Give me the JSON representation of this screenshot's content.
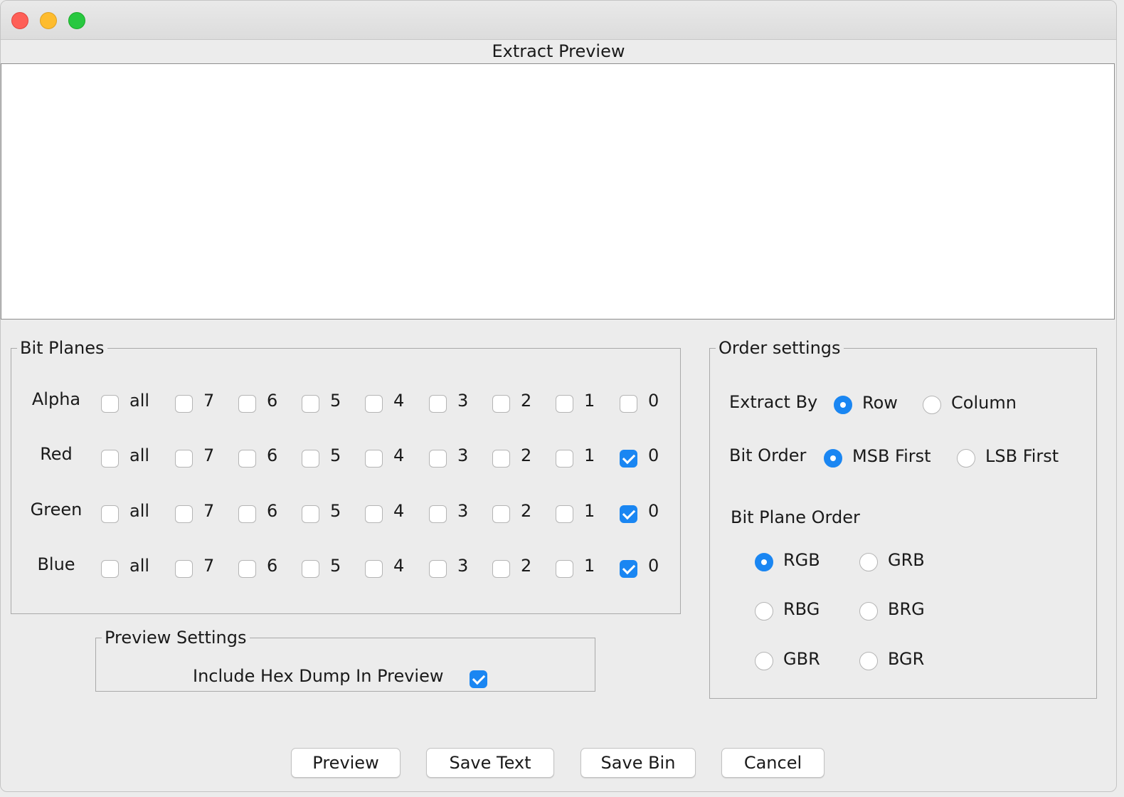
{
  "window": {
    "title": "Extract Preview",
    "preview_text": ""
  },
  "bit_planes": {
    "legend": "Bit Planes",
    "bit_labels": [
      "all",
      "7",
      "6",
      "5",
      "4",
      "3",
      "2",
      "1",
      "0"
    ],
    "rows": [
      {
        "name": "Alpha",
        "checked": [
          false,
          false,
          false,
          false,
          false,
          false,
          false,
          false,
          false
        ]
      },
      {
        "name": "Red",
        "checked": [
          false,
          false,
          false,
          false,
          false,
          false,
          false,
          false,
          true
        ]
      },
      {
        "name": "Green",
        "checked": [
          false,
          false,
          false,
          false,
          false,
          false,
          false,
          false,
          true
        ]
      },
      {
        "name": "Blue",
        "checked": [
          false,
          false,
          false,
          false,
          false,
          false,
          false,
          false,
          true
        ]
      }
    ]
  },
  "preview_settings": {
    "legend": "Preview Settings",
    "hex_dump_label": "Include Hex Dump In Preview",
    "hex_dump_checked": true
  },
  "order_settings": {
    "legend": "Order settings",
    "extract_by": {
      "label": "Extract By",
      "options": [
        "Row",
        "Column"
      ],
      "selected": "Row"
    },
    "bit_order": {
      "label": "Bit Order",
      "options": [
        "MSB First",
        "LSB First"
      ],
      "selected": "MSB First"
    },
    "bit_plane_order": {
      "label": "Bit Plane Order",
      "options": [
        "RGB",
        "GRB",
        "RBG",
        "BRG",
        "GBR",
        "BGR"
      ],
      "selected": "RGB"
    }
  },
  "buttons": {
    "preview": "Preview",
    "save_text": "Save Text",
    "save_bin": "Save Bin",
    "cancel": "Cancel"
  }
}
